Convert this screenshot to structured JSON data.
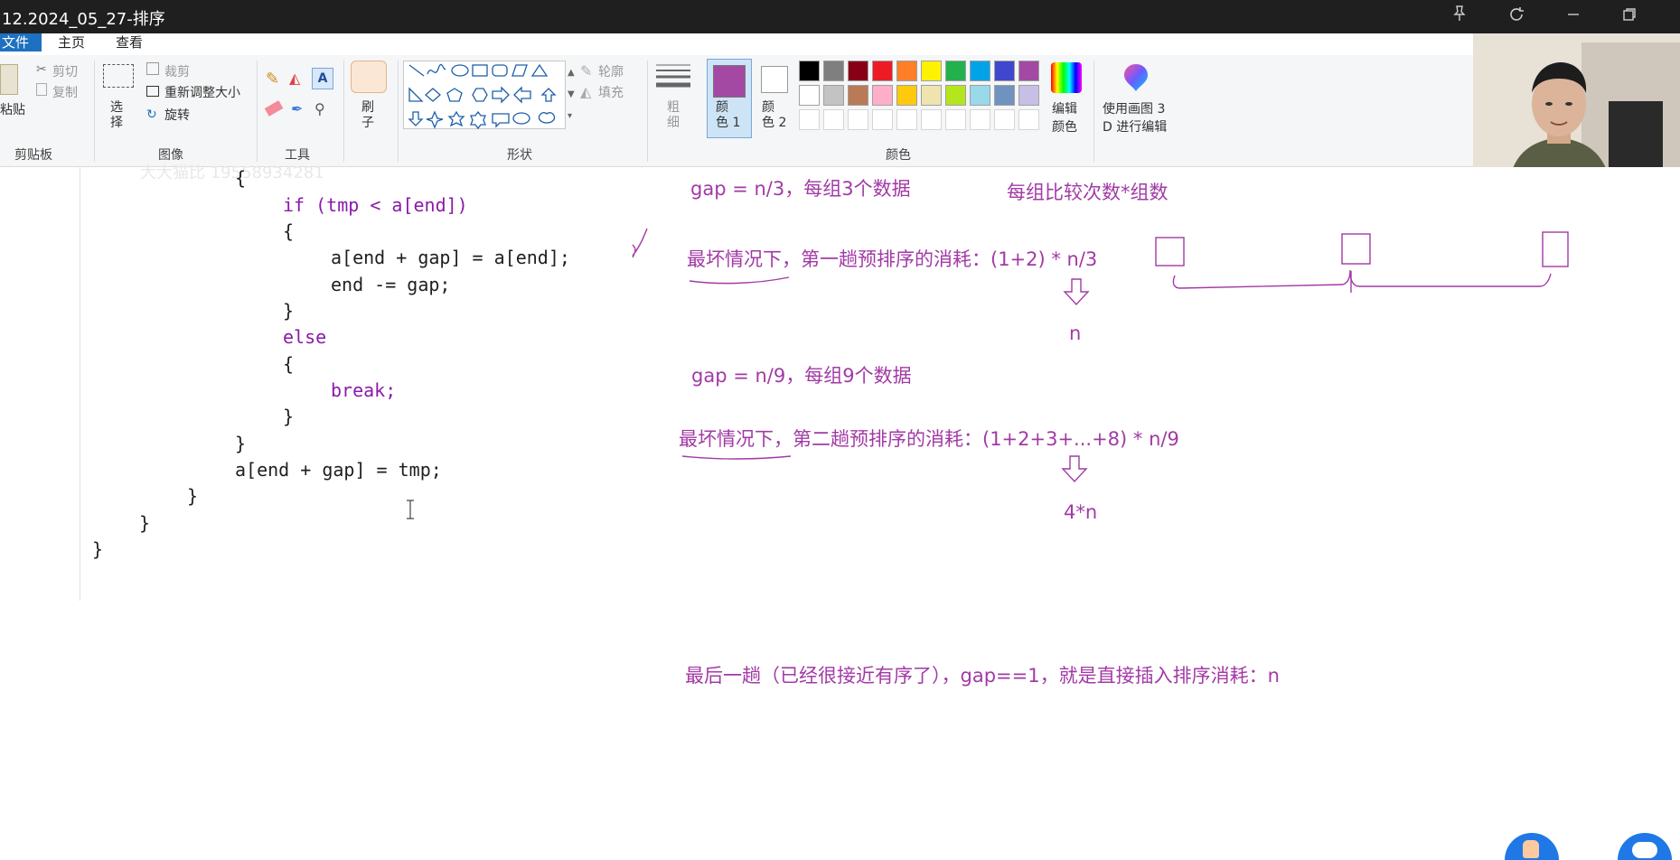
{
  "window": {
    "title": "12.2024_05_27-排序",
    "controls": [
      "pin-icon",
      "refresh-icon",
      "minimize-icon",
      "restore-icon"
    ]
  },
  "menubar": {
    "file": "文件",
    "home": "主页",
    "view": "查看"
  },
  "ribbon": {
    "clipboard": {
      "paste": "粘贴",
      "cut": "剪切",
      "copy": "复制",
      "label": "剪贴板"
    },
    "image": {
      "select": "选\n择",
      "crop": "裁剪",
      "resize": "重新调整大小",
      "rotate": "旋转",
      "label": "图像"
    },
    "tools": {
      "label": "工具"
    },
    "brushes": {
      "label": "刷\n子"
    },
    "shapes": {
      "outline": "轮廓",
      "fill": "填充",
      "label": "形状"
    },
    "size": {
      "label": "粗\n细"
    },
    "color1": "颜\n色 1",
    "color2": "颜\n色 2",
    "edit_colors": "编辑\n颜色",
    "paint3d": "使用画图 3\nD 进行编辑",
    "colors_label": "颜色",
    "colors": [
      "#000000",
      "#7f7f7f",
      "#880015",
      "#ed1c24",
      "#ff7f27",
      "#fff200",
      "#22b14c",
      "#00a2e8",
      "#3f48cc",
      "#a349a4",
      "#ffffff",
      "#c3c3c3",
      "#b97a57",
      "#ffaec9",
      "#ffc90e",
      "#efe4b0",
      "#b5e61d",
      "#99d9ea",
      "#7092be",
      "#c8bfe7"
    ],
    "selected_color": "#a349a4"
  },
  "watermark": "大大猫比 19558934281",
  "code": {
    "lines": [
      "{",
      "if (tmp < a[end])",
      "{",
      "a[end + gap] = a[end];",
      "end -= gap;",
      "}",
      "else",
      "{",
      "break;",
      "}",
      "}",
      "a[end + gap] = tmp;",
      "}",
      "}",
      "}"
    ]
  },
  "annotations": {
    "gap3": "gap = n/3，每组3个数据",
    "per_group": "每组比较次数*组数",
    "worst1": "最坏情况下，第一趟预排序的消耗：(1+2) * n/3",
    "result1": "n",
    "gap9": "gap = n/9，每组9个数据",
    "worst2": "最坏情况下，第二趟预排序的消耗：(1+2+3+...+8) * n/9",
    "result2": "4*n",
    "last": "最后一趟（已经很接近有序了），gap==1，就是直接插入排序消耗：n"
  }
}
